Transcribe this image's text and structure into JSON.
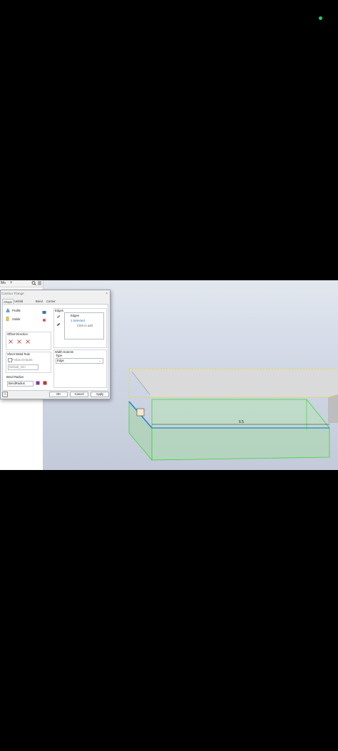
{
  "browser": {
    "tab_label": "Mo",
    "icons": [
      "plus-icon",
      "search-icon",
      "menu-icon"
    ]
  },
  "dialog": {
    "title": "Contour Flange",
    "close": "×",
    "tabs": [
      "Shape",
      "Unfold Options",
      "Bend",
      "Corner"
    ],
    "profile_label": "Profile",
    "solids_label": "Solids",
    "offset_direction_label": "Offset Direction",
    "sheet_metal_rule_label": "Sheet Metal Rule",
    "follow_defaults_label": "Follow Defaults",
    "rule_value": "Default_mm",
    "bend_radius_label": "Bend Radius",
    "bend_radius_value": "BendRadius",
    "edges_label": "Edges",
    "edges_header": "Edges",
    "edges_selected": "1 Selected",
    "edges_click_to_add": "Click to add",
    "width_extents_label": "Width Extents",
    "type_label": "Type",
    "type_value": "Edge",
    "help_label": "?",
    "ok_label": "OK",
    "cancel_label": "Cancel",
    "apply_label": "Apply"
  },
  "model": {
    "dimension_value": "6.5"
  },
  "colors": {
    "selection_green": "#3ad63a",
    "profile_yellow": "#e8d92a",
    "edge_blue": "#2b7fd8",
    "viewport_top": "#e2e7ef",
    "status_dot": "#23d16a"
  }
}
